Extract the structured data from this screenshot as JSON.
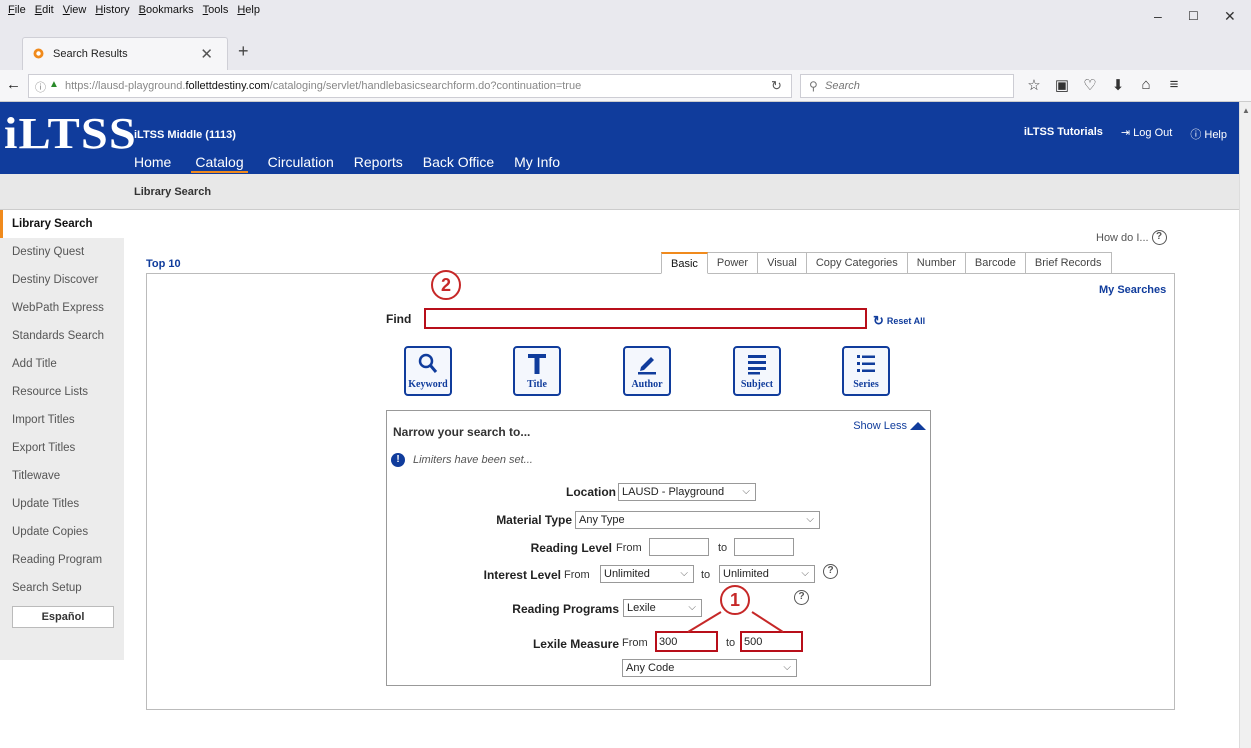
{
  "browser": {
    "menu": [
      "File",
      "Edit",
      "View",
      "History",
      "Bookmarks",
      "Tools",
      "Help"
    ],
    "tab_title": "Search Results",
    "url_prefix": "https://lausd-playground.",
    "url_domain": "follettdestiny.com",
    "url_path": "/cataloging/servlet/handlebasicsearchform.do?continuation=true",
    "search_placeholder": "Search"
  },
  "header": {
    "logo": "iLTSS",
    "site": "iLTSS Middle (1113)",
    "nav": [
      "Home",
      "Catalog",
      "Circulation",
      "Reports",
      "Back Office",
      "My Info"
    ],
    "tutorials": "iLTSS Tutorials",
    "logout": "Log Out",
    "help": "Help"
  },
  "breadcrumb": "Library Search",
  "sidebar": {
    "items": [
      "Library Search",
      "Destiny Quest",
      "Destiny Discover",
      "WebPath Express",
      "Standards Search",
      "Add Title",
      "Resource Lists",
      "Import Titles",
      "Export Titles",
      "Titlewave",
      "Update Titles",
      "Update Copies",
      "Reading Program",
      "Search Setup"
    ],
    "espanol": "Español"
  },
  "main": {
    "how_do": "How do I...",
    "top10": "Top 10",
    "tabs": [
      "Basic",
      "Power",
      "Visual",
      "Copy Categories",
      "Number",
      "Barcode",
      "Brief Records"
    ],
    "my_searches": "My Searches",
    "find_label": "Find",
    "find_value": "",
    "reset_all": "Reset All",
    "search_buttons": [
      "Keyword",
      "Title",
      "Author",
      "Subject",
      "Series"
    ]
  },
  "narrow": {
    "heading": "Narrow your search to...",
    "show_less": "Show Less",
    "limiters": "Limiters have been set...",
    "location_label": "Location",
    "location_value": "LAUSD - Playground",
    "material_label": "Material Type",
    "material_value": "Any Type",
    "reading_level_label": "Reading Level",
    "from": "From",
    "to": "to",
    "reading_from": "",
    "reading_to": "",
    "interest_label": "Interest Level",
    "interest_from": "Unlimited",
    "interest_to": "Unlimited",
    "programs_label": "Reading Programs",
    "programs_value": "Lexile",
    "lexile_label": "Lexile Measure",
    "lexile_from": "300",
    "lexile_to": "500",
    "code_value": "Any Code"
  },
  "callouts": [
    "1",
    "2"
  ]
}
